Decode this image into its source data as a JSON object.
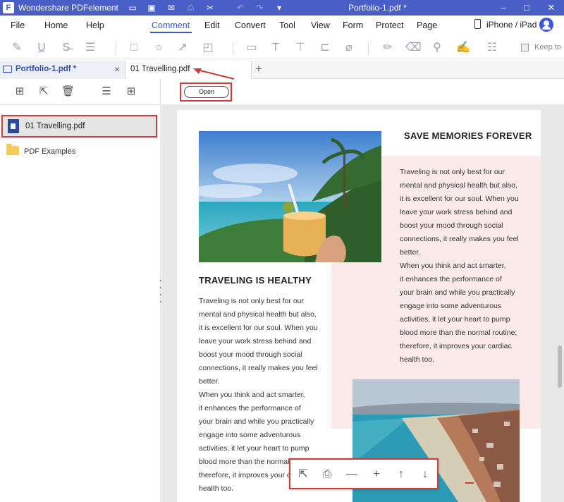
{
  "titlebar": {
    "app_name": "Wondershare PDFelement",
    "document_title": "Portfolio-1.pdf *"
  },
  "menu": {
    "items": [
      "File",
      "Home",
      "Help",
      "Comment",
      "Edit",
      "Convert",
      "Tool",
      "View",
      "Form",
      "Protect",
      "Page"
    ],
    "active": "Comment",
    "device_link": "iPhone / iPad"
  },
  "toolbar": {
    "keep_label": "Keep to"
  },
  "tabs": {
    "portfolio": "Portfolio-1.pdf *",
    "travelling": "01 Travelling.pdf"
  },
  "left_panel": {
    "file_item": "01 Travelling.pdf",
    "folder_item": "PDF Examples"
  },
  "content": {
    "open_button": "Open"
  },
  "page": {
    "heading_right": "SAVE MEMORIES FOREVER",
    "heading_left": "TRAVELING IS HEALTHY",
    "text_right": "Traveling is not only best for our\nmental and physical health but also,\nit is excellent for our soul. When you\nleave your work stress behind and\nboost your mood through social\nconnections, it really makes you feel\nbetter.\nWhen you think and act smarter,\nit enhances the performance of\nyour brain and while you practically\nengage into some adventurous\nactivities, it let your heart to pump\nblood more than the normal routine;\ntherefore, it improves your cardiac\nhealth too.",
    "text_left": "Traveling is not only best for our\nmental and physical health but also,\nit is excellent for our soul. When you\nleave your work stress behind and\nboost your mood through social\nconnections, it really makes you feel\nbetter.\nWhen you think and act smarter,\nit enhances the performance of\nyour brain and while you practically\nengage into some adventurous\nactivities, it let your heart to pump\nblood more than the normal ro\ntherefore, it improves your ca\nhealth too."
  },
  "colors": {
    "accent": "#3a58d6",
    "titlebar": "#4a5ec8",
    "highlight_red": "#d03c3c",
    "pink_block": "#fbeae9"
  }
}
